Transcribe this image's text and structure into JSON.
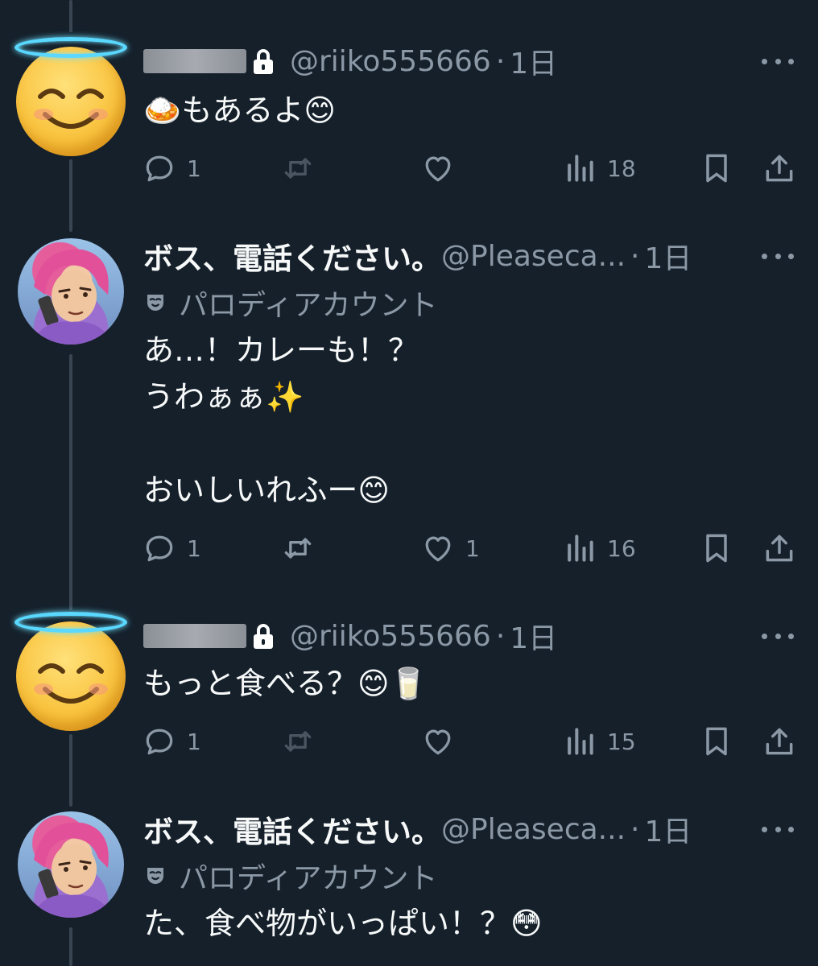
{
  "tweets": [
    {
      "handle": "@riiko555666",
      "time": "1日",
      "content": "🍛もあるよ😊",
      "avatar_icon": "smiling-halo-emoji",
      "counts": {
        "reply": "1",
        "retweet": "",
        "like": "",
        "views": "18"
      }
    },
    {
      "display_name": "ボス、電話ください。",
      "handle": "@Pleaseca...",
      "time": "1日",
      "badge": "パロディアカウント",
      "content": "あ…！カレーも！？\nうわぁぁ✨\n\nおいしいれふー😊",
      "counts": {
        "reply": "1",
        "retweet": "",
        "like": "1",
        "views": "16"
      }
    },
    {
      "handle": "@riiko555666",
      "time": "1日",
      "content": "もっと食べる？😊🥛",
      "avatar_icon": "smiling-halo-emoji",
      "counts": {
        "reply": "1",
        "retweet": "",
        "like": "",
        "views": "15"
      }
    },
    {
      "display_name": "ボス、電話ください。",
      "handle": "@Pleaseca...",
      "time": "1日",
      "badge": "パロディアカウント",
      "content": "た、食べ物がいっぱい！？😳"
    }
  ],
  "colors": {
    "background": "#15202b",
    "text": "#e7e9ea",
    "muted": "#8b98a5",
    "thread_line": "#3a4552",
    "halo": "#5ad8ff"
  }
}
